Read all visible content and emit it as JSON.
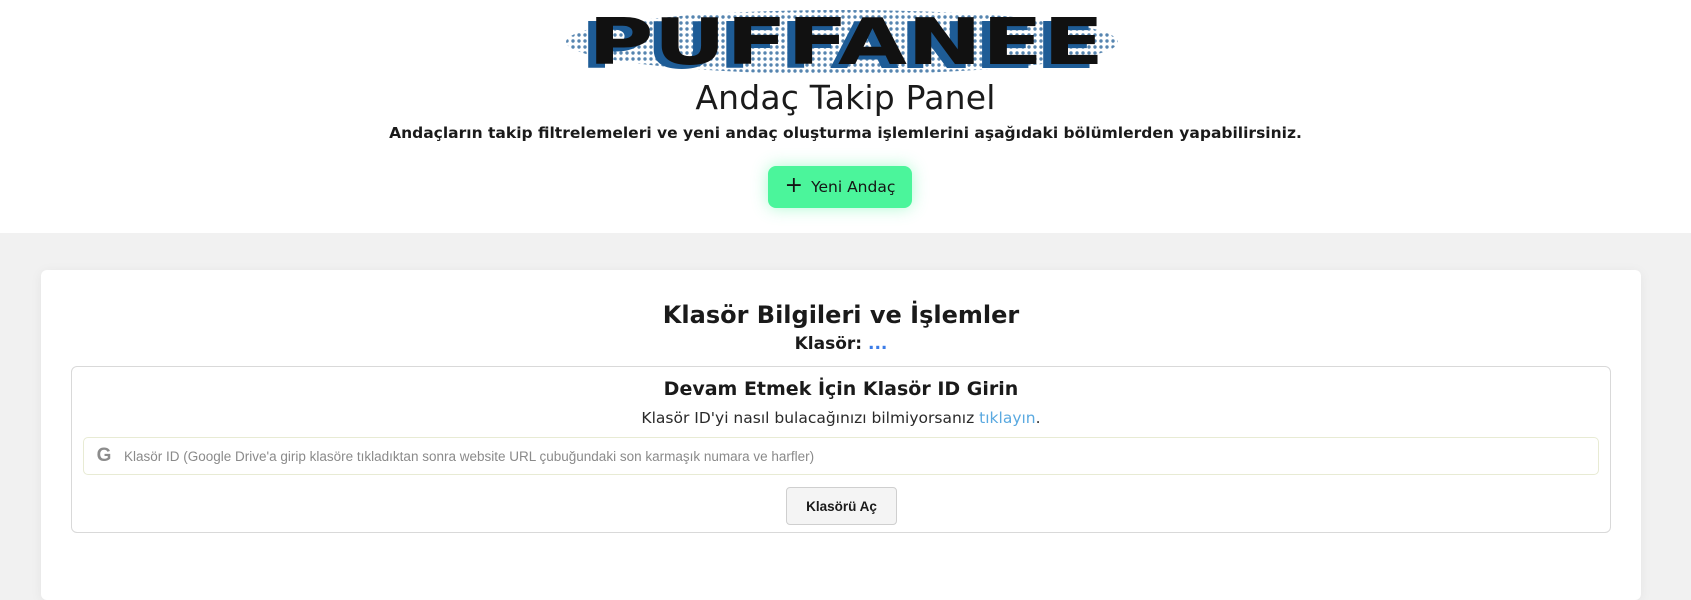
{
  "header": {
    "logo_text": "PUFFANEE",
    "title": "Andaç Takip Panel",
    "subtitle": "Andaçların takip filtrelemeleri ve yeni andaç oluşturma işlemlerini aşağıdaki bölümlerden yapabilirsiniz.",
    "new_button": {
      "icon": "plus-icon",
      "icon_glyph": "+",
      "label": "Yeni Andaç"
    }
  },
  "colors": {
    "accent_green": "#4bf59b",
    "logo_blue": "#1e5c96",
    "logo_dark": "#111111",
    "link_blue": "#5aa9e0",
    "page_bg": "#f1f1f1"
  },
  "folder_card": {
    "title": "Klasör Bilgileri ve İşlemler",
    "folder_label": "Klasör:",
    "folder_value": "...",
    "prompt": {
      "title": "Devam Etmek İçin Klasör ID Girin",
      "help_text": "Klasör ID'yi nasıl bulacağınızı bilmiyorsanız",
      "help_link": "tıklayın",
      "help_suffix": ".",
      "input_icon": "google-icon",
      "input_icon_glyph": "G",
      "input_placeholder": "Klasör ID (Google Drive'a girip klasöre tıkladıktan sonra website URL çubuğundaki son karmaşık numara ve harfler)",
      "input_value": "",
      "open_button": "Klasörü Aç"
    }
  }
}
